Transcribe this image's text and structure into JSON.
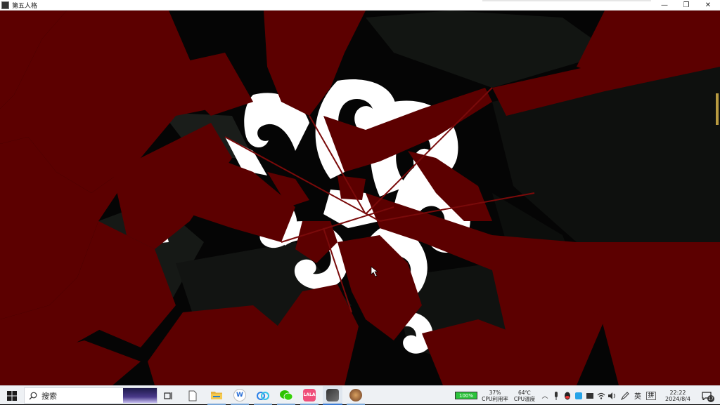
{
  "window": {
    "title": "第五人格",
    "controls": {
      "minimize": "—",
      "maximize": "❐",
      "close": "✕"
    }
  },
  "taskbar": {
    "search_label": "搜索",
    "apps": [
      {
        "name": "task-view-icon"
      },
      {
        "name": "file-icon"
      },
      {
        "name": "file-explorer-icon"
      },
      {
        "name": "wps-icon",
        "glyph": "W"
      },
      {
        "name": "baidu-netdisk-icon"
      },
      {
        "name": "wechat-icon"
      },
      {
        "name": "lala-icon",
        "glyph": "LALA"
      },
      {
        "name": "identity-v-icon"
      },
      {
        "name": "game-avatar-icon"
      }
    ],
    "tray": {
      "battery": "100%",
      "cpu_usage": "37%",
      "cpu_usage_label": "CPU利用率",
      "cpu_temp": "64℃",
      "cpu_temp_label": "CPU温度",
      "ime_lang": "英",
      "ime_mode": "拼",
      "time": "22:22",
      "date": "2024/8/4",
      "notifications": "17"
    }
  },
  "colors": {
    "shard_red": "#5c0000",
    "shard_dark": "#0f120f",
    "emblem": "#ffffff",
    "taskbar": "#eef1f4"
  }
}
